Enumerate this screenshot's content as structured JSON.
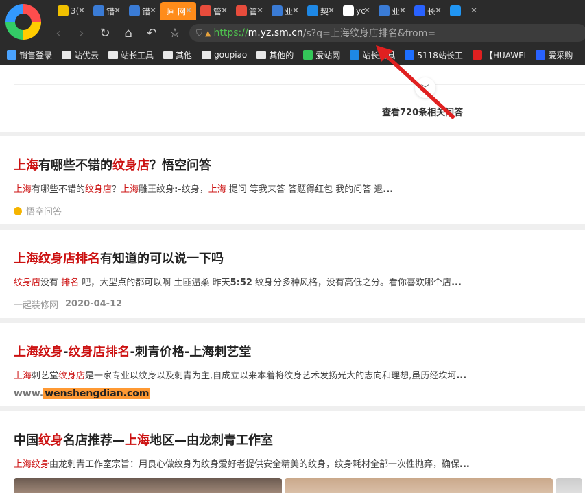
{
  "browser": {
    "tabs": [
      {
        "label": "3(",
        "icon_color": "#f0c000",
        "active": false
      },
      {
        "label": "错",
        "icon_color": "#3a7bd5",
        "active": false
      },
      {
        "label": "错",
        "icon_color": "#3a7bd5",
        "active": false
      },
      {
        "label": "网",
        "icon_color": "#ff8c1a",
        "active": true,
        "icon_char": "抻"
      },
      {
        "label": "管",
        "icon_color": "#e74c3c",
        "active": false
      },
      {
        "label": "管",
        "icon_color": "#e74c3c",
        "active": false
      },
      {
        "label": "业",
        "icon_color": "#3a7bd5",
        "active": false
      },
      {
        "label": "契",
        "icon_color": "#1e88e5",
        "active": false
      },
      {
        "label": "yc",
        "icon_color": "#ffffff",
        "active": false
      },
      {
        "label": "业",
        "icon_color": "#3a7bd5",
        "active": false
      },
      {
        "label": "长",
        "icon_color": "#2962ff",
        "active": false
      },
      {
        "label": "",
        "icon_color": "#2196f3",
        "active": false
      }
    ],
    "url": {
      "scheme": "https://",
      "host": "m.yz.sm.cn",
      "rest": "/s?q=上海纹身店排名&from="
    },
    "bookmarks": [
      {
        "label": "销售登录",
        "type": "site",
        "color": "#4aa3ff"
      },
      {
        "label": "站优云",
        "type": "folder"
      },
      {
        "label": "站长工具",
        "type": "folder"
      },
      {
        "label": "其他",
        "type": "folder"
      },
      {
        "label": "goupiao",
        "type": "folder"
      },
      {
        "label": "其他的",
        "type": "folder"
      },
      {
        "label": "爱站网",
        "type": "site",
        "color": "#34c759"
      },
      {
        "label": "站长工具",
        "type": "site",
        "color": "#1e88e5"
      },
      {
        "label": "5118站长工",
        "type": "site",
        "color": "#1e6fff"
      },
      {
        "label": "【HUAWEI",
        "type": "site",
        "color": "#e02020"
      },
      {
        "label": "爱采购",
        "type": "site",
        "color": "#2962ff"
      }
    ]
  },
  "more": {
    "text": "查看720条相关问答"
  },
  "results": [
    {
      "title": [
        {
          "t": "上海",
          "red": true
        },
        {
          "t": "有哪些不错的",
          "red": false
        },
        {
          "t": "纹身店",
          "red": true
        },
        {
          "t": "？悟空问答",
          "red": false
        }
      ],
      "snippet": [
        {
          "t": "上海",
          "red": true
        },
        {
          "t": "有哪些不错的",
          "red": false
        },
        {
          "t": "纹身店",
          "red": true
        },
        {
          "t": "？",
          "red": false
        },
        {
          "t": "上海",
          "red": true
        },
        {
          "t": "雕王纹身",
          "red": false
        },
        {
          "t": ":-",
          "red": false,
          "bold": true
        },
        {
          "t": "纹身，",
          "red": false
        },
        {
          "t": "上海",
          "red": true
        },
        {
          "t": " 提问 等我来答 答题得红包 我的问答 退",
          "red": false
        },
        {
          "t": "...",
          "red": false,
          "bold": true
        }
      ],
      "source": "悟空问答",
      "date": ""
    },
    {
      "title": [
        {
          "t": "上海纹身店排名",
          "red": true
        },
        {
          "t": "有知道的可以说一下吗",
          "red": false
        }
      ],
      "snippet": [
        {
          "t": "纹身店",
          "red": true
        },
        {
          "t": "没有 ",
          "red": false
        },
        {
          "t": "排名",
          "red": true
        },
        {
          "t": " 吧，大型点的都可以啊 土匪温柔 昨天",
          "red": false
        },
        {
          "t": "5:52",
          "red": false,
          "bold": true
        },
        {
          "t": " 纹身分多种风格，没有高低之分。看你喜欢哪个店",
          "red": false
        },
        {
          "t": "...",
          "red": false,
          "bold": true
        }
      ],
      "source": "一起装修网",
      "date": "2020-04-12"
    },
    {
      "title": [
        {
          "t": "上海纹身",
          "red": true
        },
        {
          "t": "-",
          "red": false
        },
        {
          "t": "纹身店排名",
          "red": true
        },
        {
          "t": "-刺青价格-上海刺艺堂",
          "red": false
        }
      ],
      "snippet": [
        {
          "t": "上海",
          "red": true
        },
        {
          "t": "刺艺堂",
          "red": false
        },
        {
          "t": "纹身店",
          "red": true
        },
        {
          "t": "是一家专业以纹身以及刺青为主,自成立以来本着将纹身艺术发扬光大的志向和理想,虽历经坎坷",
          "red": false
        },
        {
          "t": "...",
          "red": false,
          "bold": true
        }
      ],
      "url_prefix": "www.",
      "url_highlight": "wenshengdian.com"
    },
    {
      "title": [
        {
          "t": "中国",
          "red": false
        },
        {
          "t": "纹身",
          "red": true
        },
        {
          "t": "名店推荐—",
          "red": false
        },
        {
          "t": "上海",
          "red": true
        },
        {
          "t": "地区—由龙刺青工作室",
          "red": false
        }
      ],
      "snippet": [
        {
          "t": "上海纹身",
          "red": true
        },
        {
          "t": "由龙刺青工作室宗旨：用良心做纹身为纹身爱好者提供安全精美的纹身，纹身耗材全部一次性抛弃，确保",
          "red": false
        },
        {
          "t": "...",
          "red": false,
          "bold": true
        }
      ]
    }
  ],
  "colors": {
    "highlight_red": "#cc1111",
    "annotation_arrow": "#e02020",
    "url_green": "#4ec24e"
  }
}
